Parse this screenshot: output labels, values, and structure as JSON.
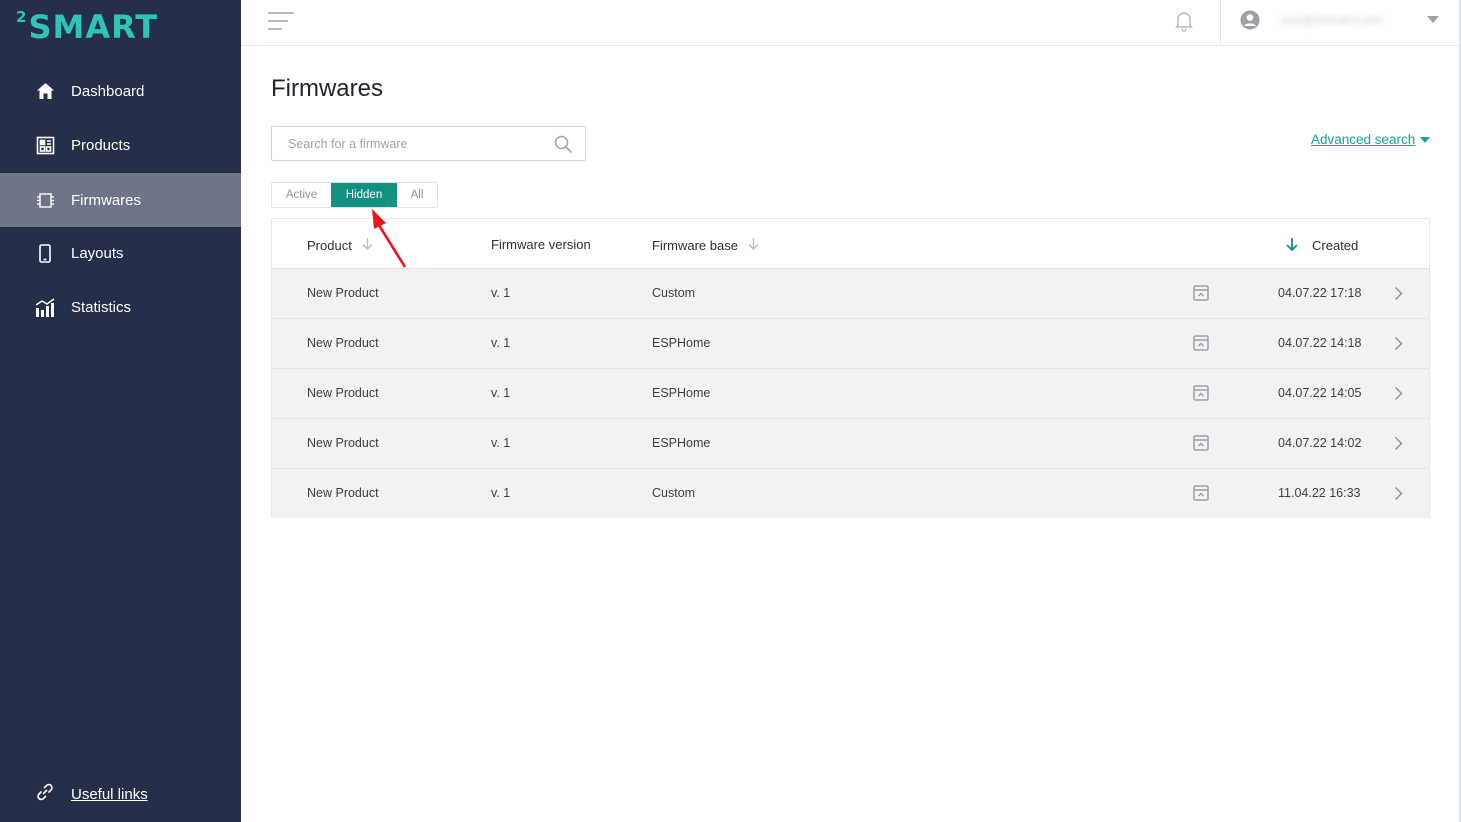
{
  "app": {
    "logo_prefix": "2",
    "logo_text": "SMART"
  },
  "sidebar": {
    "items": [
      {
        "label": "Dashboard",
        "icon": "home-icon"
      },
      {
        "label": "Products",
        "icon": "products-icon"
      },
      {
        "label": "Firmwares",
        "icon": "chip-icon",
        "active": true
      },
      {
        "label": "Layouts",
        "icon": "phone-icon"
      },
      {
        "label": "Statistics",
        "icon": "statistics-icon"
      }
    ],
    "useful_links": "Useful links"
  },
  "topbar": {
    "user_email": "xxx@2smart.com"
  },
  "page": {
    "title": "Firmwares"
  },
  "search": {
    "placeholder": "Search for a firmware",
    "value": ""
  },
  "advanced_search": "Advanced search",
  "tabs": [
    {
      "label": "Active"
    },
    {
      "label": "Hidden",
      "selected": true
    },
    {
      "label": "All"
    }
  ],
  "table": {
    "headers": {
      "product": "Product",
      "version": "Firmware version",
      "base": "Firmware base",
      "created": "Created"
    },
    "rows": [
      {
        "product": "New Product",
        "version": "v. 1",
        "base": "Custom",
        "created": "04.07.22 17:18"
      },
      {
        "product": "New Product",
        "version": "v. 1",
        "base": "ESPHome",
        "created": "04.07.22 14:18"
      },
      {
        "product": "New Product",
        "version": "v. 1",
        "base": "ESPHome",
        "created": "04.07.22 14:05"
      },
      {
        "product": "New Product",
        "version": "v. 1",
        "base": "ESPHome",
        "created": "04.07.22 14:02"
      },
      {
        "product": "New Product",
        "version": "v. 1",
        "base": "Custom",
        "created": "11.04.22 16:33"
      }
    ]
  },
  "colors": {
    "accent": "#129080",
    "sidebar": "#262f4a",
    "active_nav": "#6f7587",
    "annotation_arrow": "#e8161b"
  }
}
